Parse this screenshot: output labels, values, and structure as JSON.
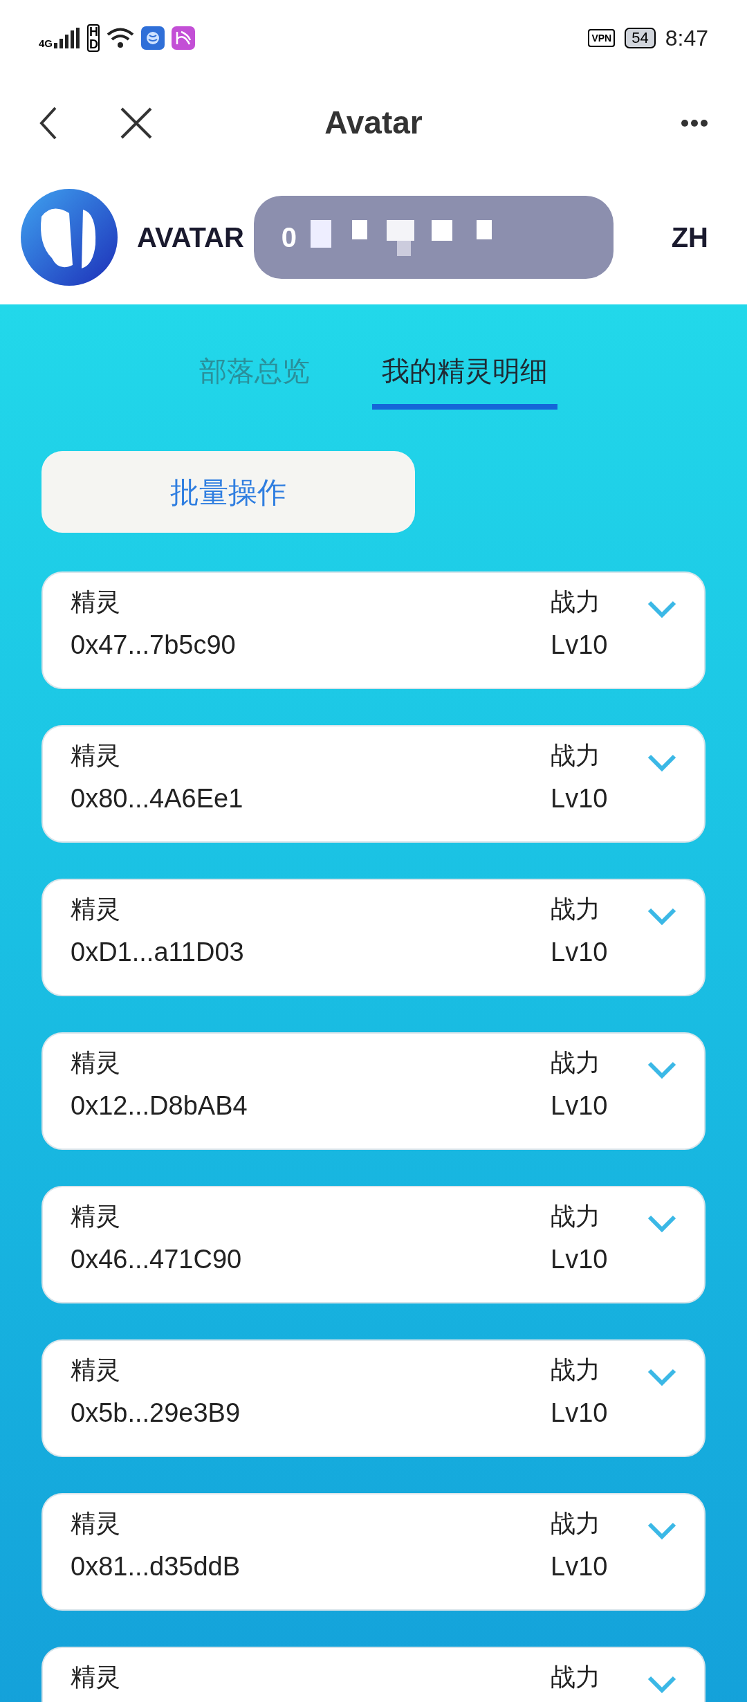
{
  "status_bar": {
    "network": "4G",
    "hd": "HD",
    "vpn": "VPN",
    "battery": "54",
    "time": "8:47"
  },
  "nav": {
    "title": "Avatar"
  },
  "header": {
    "brand": "AVATAR",
    "wallet_address": "0",
    "language": "ZH"
  },
  "tabs": [
    {
      "label": "部落总览",
      "selected": false
    },
    {
      "label": "我的精灵明细",
      "selected": true
    }
  ],
  "batch_button": "批量操作",
  "spirits": [
    {
      "label": "精灵",
      "address": "0x47...7b5c90",
      "power_label": "战力",
      "level": "Lv10",
      "expanded": false
    },
    {
      "label": "精灵",
      "address": "0x80...4A6Ee1",
      "power_label": "战力",
      "level": "Lv10",
      "expanded": false
    },
    {
      "label": "精灵",
      "address": "0xD1...a11D03",
      "power_label": "战力",
      "level": "Lv10",
      "expanded": false
    },
    {
      "label": "精灵",
      "address": "0x12...D8bAB4",
      "power_label": "战力",
      "level": "Lv10",
      "expanded": false
    },
    {
      "label": "精灵",
      "address": "0x46...471C90",
      "power_label": "战力",
      "level": "Lv10",
      "expanded": false
    },
    {
      "label": "精灵",
      "address": "0x5b...29e3B9",
      "power_label": "战力",
      "level": "Lv10",
      "expanded": false
    },
    {
      "label": "精灵",
      "address": "0x81...d35ddB",
      "power_label": "战力",
      "level": "Lv10",
      "expanded": false
    },
    {
      "label": "精灵",
      "power_label": "战力",
      "expanded": false
    }
  ]
}
